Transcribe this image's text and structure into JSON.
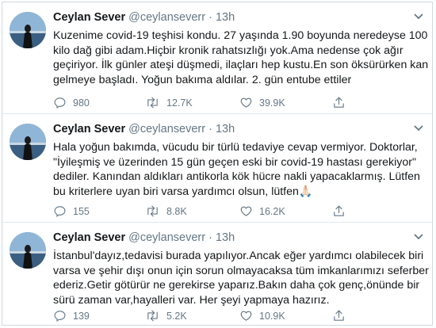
{
  "tweets": [
    {
      "name": "Ceylan Sever",
      "handle": "@ceylanseverr",
      "dot": "·",
      "time": "13h",
      "text": "Kuzenime covid-19 teşhisi kondu. 27 yaşında 1.90 boyunda neredeyse 100 kilo dağ gibi adam.Hiçbir kronik rahatsızlığı yok.Ama nedense çok ağır geçiriyor. İlk günler ateşi düşmedi, ilaçları hep kustu.En son öksürürken kan gelmeye başladı. Yoğun bakıma aldılar. 2. gün entube ettiler",
      "replies": "980",
      "retweets": "12.7K",
      "likes": "39.9K"
    },
    {
      "name": "Ceylan Sever",
      "handle": "@ceylanseverr",
      "dot": "·",
      "time": "13h",
      "text": "Hala yoğun bakımda, vücudu bir türlü tedaviye cevap vermiyor. Doktorlar, \"İyileşmiş ve üzerinden 15 gün geçen eski bir covid-19 hastası gerekiyor\" dediler. Kanından aldıkları antikorla kök hücre nakli yapacaklarmış. Lütfen bu kriterlere uyan biri varsa yardımcı olsun, lütfen🙏🏻",
      "replies": "155",
      "retweets": "8.8K",
      "likes": "16.2K"
    },
    {
      "name": "Ceylan Sever",
      "handle": "@ceylanseverr",
      "dot": "·",
      "time": "13h",
      "text": "İstanbul'dayız,tedavisi burada yapılıyor.Ancak eğer yardımcı olabilecek biri varsa ve şehir dışı onun için sorun olmayacaksa tüm imkanlarımızı seferber ederiz.Getir götürür ne gerekirse yaparız.Bakın daha çok genç,önünde bir sürü zaman var,hayalleri var. Her şeyi yapmaya hazırız.",
      "replies": "139",
      "retweets": "5.2K",
      "likes": "10.9K"
    }
  ],
  "icons": {
    "reply": "reply-icon",
    "retweet": "retweet-icon",
    "like": "heart-icon",
    "share": "share-icon",
    "menu": "chevron-down-icon"
  },
  "colors": {
    "text": "#14171a",
    "secondary": "#657786",
    "border": "#e1e8ed"
  }
}
